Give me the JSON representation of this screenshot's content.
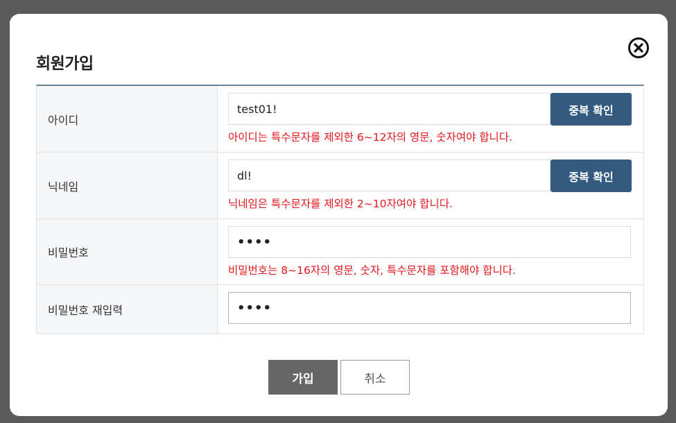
{
  "modal": {
    "title": "회원가입",
    "close_icon": "close-circle-icon"
  },
  "form": {
    "id": {
      "label": "아이디",
      "value": "test01!",
      "button": "중복 확인",
      "error": "아이디는 특수문자를 제외한 6~12자의 영문, 숫자여야 합니다."
    },
    "nickname": {
      "label": "닉네임",
      "value": "dl!",
      "button": "중복 확인",
      "error": "닉네임은 특수문자를 제외한 2~10자여야 합니다."
    },
    "password": {
      "label": "비밀번호",
      "value": "••••",
      "error": "비밀번호는 8~16자의 영문, 숫자, 특수문자를 포함해야 합니다."
    },
    "password_confirm": {
      "label": "비밀번호 재입력",
      "value": "••••"
    }
  },
  "actions": {
    "join": "가입",
    "cancel": "취소"
  },
  "colors": {
    "check_button": "#345a80",
    "join_button": "#666666",
    "error_text": "#e8151b",
    "table_top_border": "#6e8194"
  }
}
